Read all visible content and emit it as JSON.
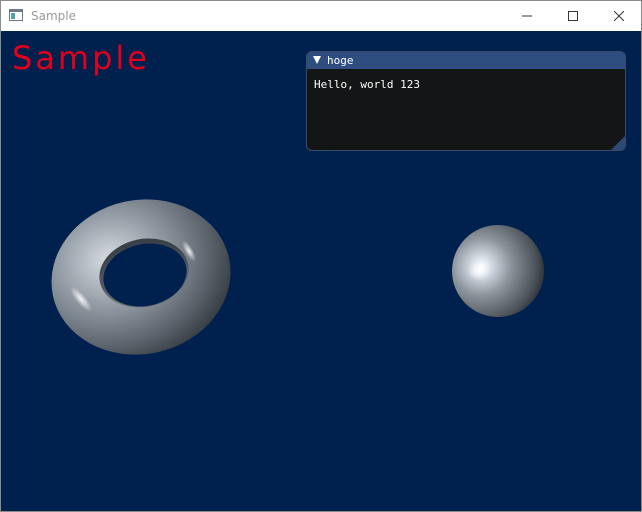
{
  "window": {
    "title": "Sample",
    "app_icon": "app-window-icon",
    "controls": [
      "minimize-icon",
      "maximize-icon",
      "close-icon"
    ]
  },
  "viewport": {
    "background_color": "#00214d",
    "label": "Sample",
    "label_color": "#e1001b"
  },
  "debug_window": {
    "title": "hoge",
    "collapse_icon": "collapse-arrow-icon",
    "text": "Hello, world 123",
    "titlebar_color": "#2e4e80",
    "body_color": "#141516"
  },
  "scene": {
    "objects": [
      "torus",
      "sphere"
    ],
    "material_color": "#9aa2ab"
  }
}
